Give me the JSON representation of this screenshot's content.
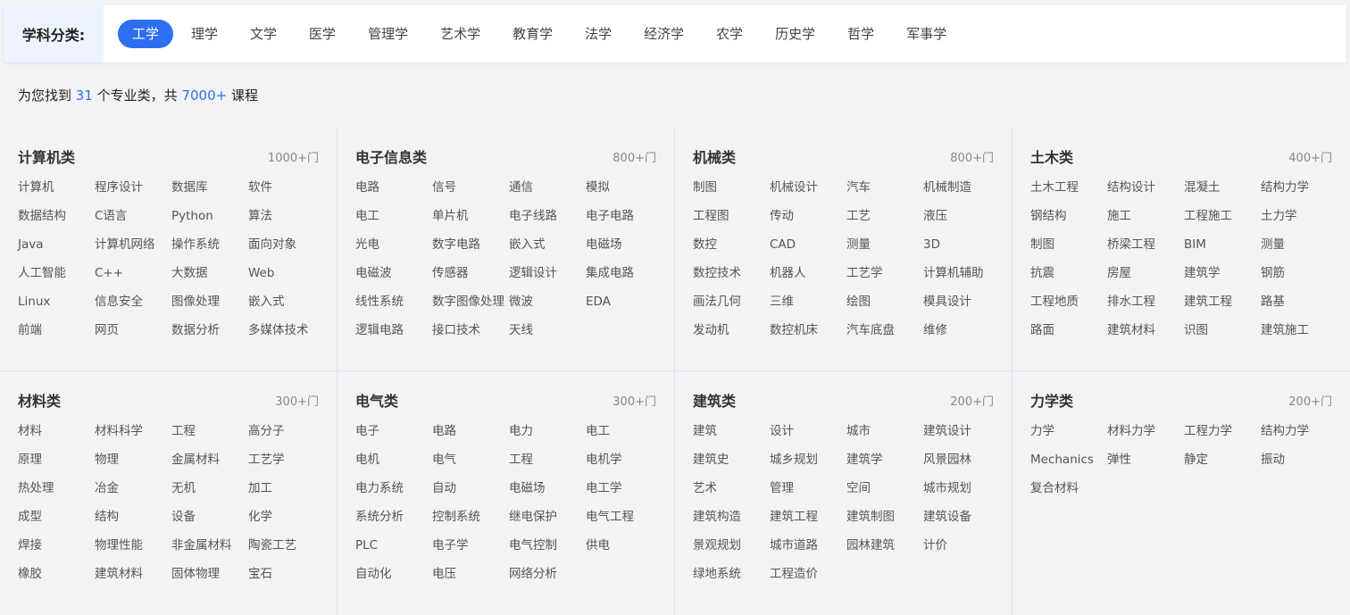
{
  "filter": {
    "label": "学科分类:",
    "tabs": [
      "工学",
      "理学",
      "文学",
      "医学",
      "管理学",
      "艺术学",
      "教育学",
      "法学",
      "经济学",
      "农学",
      "历史学",
      "哲学",
      "军事学"
    ],
    "active": "工学"
  },
  "summary": {
    "prefix": "为您找到",
    "major_count": "31",
    "middle": "个专业类，共",
    "course_count": "7000+",
    "suffix": "课程"
  },
  "colors": {
    "accent": "#2e6ff2",
    "label_bg": "#eef4ff",
    "page_bg": "#f2f3f5"
  },
  "categories": [
    {
      "title": "计算机类",
      "count": "1000+门",
      "items": [
        "计算机",
        "程序设计",
        "数据库",
        "软件",
        "数据结构",
        "C语言",
        "Python",
        "算法",
        "Java",
        "计算机网络",
        "操作系统",
        "面向对象",
        "人工智能",
        "C++",
        "大数据",
        "Web",
        "Linux",
        "信息安全",
        "图像处理",
        "嵌入式",
        "前端",
        "网页",
        "数据分析",
        "多媒体技术"
      ]
    },
    {
      "title": "电子信息类",
      "count": "800+门",
      "items": [
        "电路",
        "信号",
        "通信",
        "模拟",
        "电工",
        "单片机",
        "电子线路",
        "电子电路",
        "光电",
        "数字电路",
        "嵌入式",
        "电磁场",
        "电磁波",
        "传感器",
        "逻辑设计",
        "集成电路",
        "线性系统",
        "数字图像处理",
        "微波",
        "EDA",
        "逻辑电路",
        "接口技术",
        "天线"
      ]
    },
    {
      "title": "机械类",
      "count": "800+门",
      "items": [
        "制图",
        "机械设计",
        "汽车",
        "机械制造",
        "工程图",
        "传动",
        "工艺",
        "液压",
        "数控",
        "CAD",
        "测量",
        "3D",
        "数控技术",
        "机器人",
        "工艺学",
        "计算机辅助",
        "画法几何",
        "三维",
        "绘图",
        "模具设计",
        "发动机",
        "数控机床",
        "汽车底盘",
        "维修"
      ]
    },
    {
      "title": "土木类",
      "count": "400+门",
      "items": [
        "土木工程",
        "结构设计",
        "混凝土",
        "结构力学",
        "钢结构",
        "施工",
        "工程施工",
        "土力学",
        "制图",
        "桥梁工程",
        "BIM",
        "测量",
        "抗震",
        "房屋",
        "建筑学",
        "钢筋",
        "工程地质",
        "排水工程",
        "建筑工程",
        "路基",
        "路面",
        "建筑材料",
        "识图",
        "建筑施工"
      ]
    },
    {
      "title": "材料类",
      "count": "300+门",
      "items": [
        "材料",
        "材料科学",
        "工程",
        "高分子",
        "原理",
        "物理",
        "金属材料",
        "工艺学",
        "热处理",
        "冶金",
        "无机",
        "加工",
        "成型",
        "结构",
        "设备",
        "化学",
        "焊接",
        "物理性能",
        "非金属材料",
        "陶瓷工艺",
        "橡胶",
        "建筑材料",
        "固体物理",
        "宝石"
      ]
    },
    {
      "title": "电气类",
      "count": "300+门",
      "items": [
        "电子",
        "电路",
        "电力",
        "电工",
        "电机",
        "电气",
        "工程",
        "电机学",
        "电力系统",
        "自动",
        "电磁场",
        "电工学",
        "系统分析",
        "控制系统",
        "继电保护",
        "电气工程",
        "PLC",
        "电子学",
        "电气控制",
        "供电",
        "自动化",
        "电压",
        "网络分析"
      ]
    },
    {
      "title": "建筑类",
      "count": "200+门",
      "items": [
        "建筑",
        "设计",
        "城市",
        "建筑设计",
        "建筑史",
        "城乡规划",
        "建筑学",
        "风景园林",
        "艺术",
        "管理",
        "空间",
        "城市规划",
        "建筑构造",
        "建筑工程",
        "建筑制图",
        "建筑设备",
        "景观规划",
        "城市道路",
        "园林建筑",
        "计价",
        "绿地系统",
        "工程造价"
      ]
    },
    {
      "title": "力学类",
      "count": "200+门",
      "items": [
        "力学",
        "材料力学",
        "工程力学",
        "结构力学",
        "Mechanics",
        "弹性",
        "静定",
        "振动",
        "复合材料"
      ]
    }
  ]
}
